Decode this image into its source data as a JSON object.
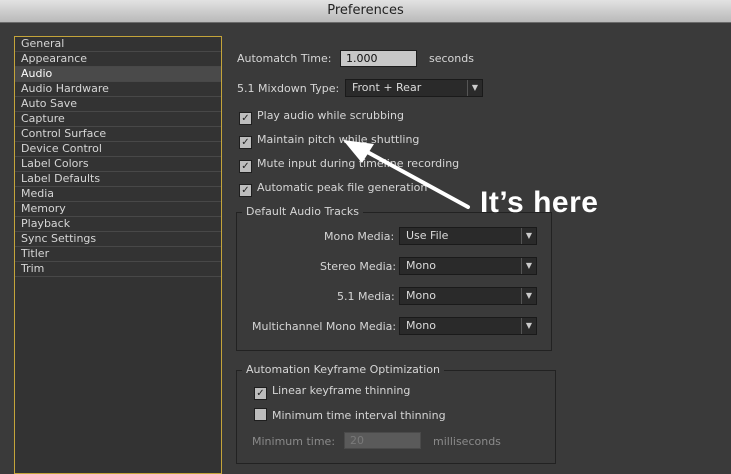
{
  "window": {
    "title": "Preferences"
  },
  "categories": [
    {
      "label": "General"
    },
    {
      "label": "Appearance"
    },
    {
      "label": "Audio"
    },
    {
      "label": "Audio Hardware"
    },
    {
      "label": "Auto Save"
    },
    {
      "label": "Capture"
    },
    {
      "label": "Control Surface"
    },
    {
      "label": "Device Control"
    },
    {
      "label": "Label Colors"
    },
    {
      "label": "Label Defaults"
    },
    {
      "label": "Media"
    },
    {
      "label": "Memory"
    },
    {
      "label": "Playback"
    },
    {
      "label": "Sync Settings"
    },
    {
      "label": "Titler"
    },
    {
      "label": "Trim"
    }
  ],
  "selected_category": "Audio",
  "audio": {
    "automatch_label": "Automatch Time:",
    "automatch_value": "1.000",
    "automatch_unit": "seconds",
    "mixdown_label": "5.1 Mixdown Type:",
    "mixdown_value": "Front + Rear",
    "options": [
      {
        "label": "Play audio while scrubbing",
        "checked": true
      },
      {
        "label": "Maintain pitch while shuttling",
        "checked": true
      },
      {
        "label": "Mute input during timeline recording",
        "checked": true
      },
      {
        "label": "Automatic peak file generation",
        "checked": true
      }
    ],
    "default_tracks": {
      "title": "Default Audio Tracks",
      "rows": [
        {
          "label": "Mono Media:",
          "value": "Use File"
        },
        {
          "label": "Stereo Media:",
          "value": "Mono"
        },
        {
          "label": "5.1 Media:",
          "value": "Mono"
        },
        {
          "label": "Multichannel Mono Media:",
          "value": "Mono"
        }
      ]
    },
    "keyframe": {
      "title": "Automation Keyframe Optimization",
      "linear_label": "Linear keyframe thinning",
      "linear_checked": true,
      "mintime_label": "Minimum time interval thinning",
      "mintime_checked": false,
      "minimum_time_label": "Minimum time:",
      "minimum_time_value": "20",
      "minimum_time_unit": "milliseconds"
    }
  },
  "annotation": {
    "text": "It’s here",
    "color": "#ffffff"
  },
  "check_glyph": "✓"
}
